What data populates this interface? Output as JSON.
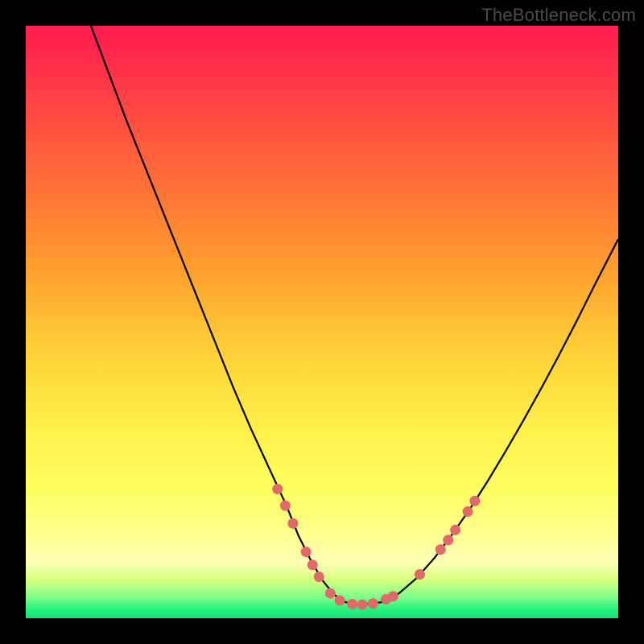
{
  "watermark": "TheBottleneck.com",
  "chart_data": {
    "type": "line",
    "title": "",
    "xlabel": "",
    "ylabel": "",
    "xlim": [
      0,
      100
    ],
    "ylim": [
      0,
      100
    ],
    "grid": false,
    "legend": false,
    "background": {
      "type": "vertical-gradient",
      "stops": [
        {
          "offset": 0.0,
          "color": "#ff1a4f"
        },
        {
          "offset": 0.1,
          "color": "#ff3a47"
        },
        {
          "offset": 0.25,
          "color": "#ff6a3a"
        },
        {
          "offset": 0.4,
          "color": "#ff9a2e"
        },
        {
          "offset": 0.55,
          "color": "#ffd138"
        },
        {
          "offset": 0.68,
          "color": "#fff04a"
        },
        {
          "offset": 0.78,
          "color": "#ffff60"
        },
        {
          "offset": 0.85,
          "color": "#ffff8a"
        },
        {
          "offset": 0.905,
          "color": "#ffffb5"
        },
        {
          "offset": 0.935,
          "color": "#d6ff80"
        },
        {
          "offset": 0.965,
          "color": "#7dff8a"
        },
        {
          "offset": 0.985,
          "color": "#27f07f"
        },
        {
          "offset": 1.0,
          "color": "#17e276"
        }
      ]
    },
    "series": [
      {
        "name": "bottleneck-curve",
        "color": "#000000",
        "x": [
          11,
          14,
          17,
          20,
          23,
          26,
          29,
          32,
          35,
          38,
          41,
          44,
          46,
          48,
          50,
          52,
          54,
          57,
          60,
          63,
          66,
          69,
          72,
          75,
          78,
          81,
          84,
          87,
          90,
          93,
          96,
          100
        ],
        "y": [
          100,
          92,
          84,
          76.5,
          69,
          61.5,
          54,
          46.5,
          39,
          32,
          25.5,
          19,
          14,
          10,
          6.5,
          4,
          2.7,
          2.3,
          2.7,
          4.2,
          6.8,
          10.2,
          14.2,
          18.5,
          23.2,
          28.2,
          33.4,
          38.8,
          44.4,
          50.2,
          56.2,
          64
        ]
      }
    ],
    "markers": {
      "name": "curve-dots",
      "color": "#e06a6a",
      "radius": 6.5,
      "points": [
        {
          "x": 42.5,
          "y": 21.8
        },
        {
          "x": 43.8,
          "y": 19.0
        },
        {
          "x": 45.1,
          "y": 16.0
        },
        {
          "x": 47.3,
          "y": 11.2
        },
        {
          "x": 48.4,
          "y": 9.0
        },
        {
          "x": 49.5,
          "y": 7.0
        },
        {
          "x": 51.4,
          "y": 4.2
        },
        {
          "x": 53.0,
          "y": 3.0
        },
        {
          "x": 55.1,
          "y": 2.4
        },
        {
          "x": 56.8,
          "y": 2.3
        },
        {
          "x": 58.6,
          "y": 2.5
        },
        {
          "x": 60.8,
          "y": 3.2
        },
        {
          "x": 62.0,
          "y": 3.7
        },
        {
          "x": 66.5,
          "y": 7.4
        },
        {
          "x": 70.0,
          "y": 11.6
        },
        {
          "x": 71.3,
          "y": 13.2
        },
        {
          "x": 72.5,
          "y": 14.9
        },
        {
          "x": 74.6,
          "y": 18.0
        },
        {
          "x": 75.8,
          "y": 19.8
        }
      ]
    }
  }
}
